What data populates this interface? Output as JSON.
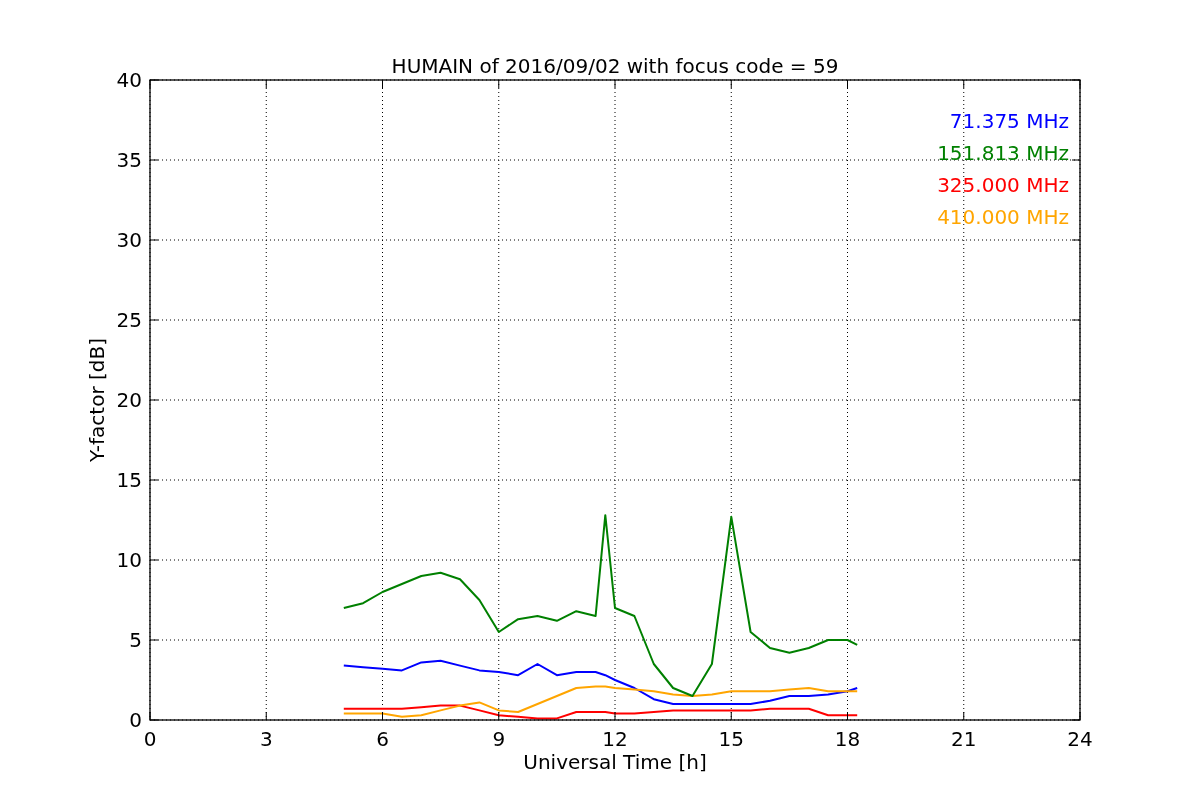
{
  "figure": {
    "chart_data": {
      "type": "line",
      "title": "HUMAIN of 2016/09/02 with focus code = 59",
      "xlabel": "Universal Time [h]",
      "ylabel": "Y-factor [dB]",
      "x": [
        5,
        5.5,
        6,
        6.5,
        7,
        7.5,
        8,
        8.5,
        9,
        9.5,
        10,
        10.5,
        11,
        11.5,
        11.75,
        12,
        12.5,
        13,
        13.5,
        14,
        14.5,
        15,
        15.5,
        16,
        16.5,
        17,
        17.5,
        18,
        18.25
      ],
      "series": [
        {
          "name": "71.375 MHz",
          "color": "#0000ff",
          "values": [
            3.4,
            3.3,
            3.2,
            3.1,
            3.6,
            3.7,
            3.4,
            3.1,
            3.0,
            2.8,
            3.5,
            2.8,
            3,
            3,
            2.8,
            2.5,
            2,
            1.3,
            1,
            1,
            1,
            1,
            1,
            1.2,
            1.5,
            1.5,
            1.6,
            1.8,
            2.0
          ]
        },
        {
          "name": "151.813 MHz",
          "color": "#008000",
          "values": [
            7,
            7.3,
            8,
            8.5,
            9,
            9.2,
            8.8,
            7.5,
            5.5,
            6.3,
            6.5,
            6.2,
            6.8,
            6.5,
            12.8,
            7,
            6.5,
            3.5,
            2,
            1.5,
            3.5,
            12.7,
            5.5,
            4.5,
            4.2,
            4.5,
            5,
            5,
            4.7
          ]
        },
        {
          "name": "325.000 MHz",
          "color": "#ff0000",
          "values": [
            0.7,
            0.7,
            0.7,
            0.7,
            0.8,
            0.9,
            0.9,
            0.6,
            0.3,
            0.2,
            0.1,
            0.1,
            0.5,
            0.5,
            0.5,
            0.4,
            0.4,
            0.5,
            0.6,
            0.6,
            0.6,
            0.6,
            0.6,
            0.7,
            0.7,
            0.7,
            0.3,
            0.3,
            0.3
          ]
        },
        {
          "name": "410.000 MHz",
          "color": "#ffa500",
          "values": [
            0.4,
            0.4,
            0.4,
            0.2,
            0.3,
            0.6,
            0.9,
            1.1,
            0.6,
            0.5,
            1,
            1.5,
            2,
            2.1,
            2.1,
            2.0,
            1.9,
            1.8,
            1.6,
            1.5,
            1.6,
            1.8,
            1.8,
            1.8,
            1.9,
            2,
            1.8,
            1.8,
            1.8
          ]
        }
      ],
      "grid": true,
      "xlim": [
        0,
        24
      ],
      "ylim": [
        0,
        40
      ],
      "xticks": [
        0,
        3,
        6,
        9,
        12,
        15,
        18,
        21,
        24
      ],
      "yticks": [
        0,
        5,
        10,
        15,
        20,
        25,
        30,
        35,
        40
      ]
    }
  }
}
